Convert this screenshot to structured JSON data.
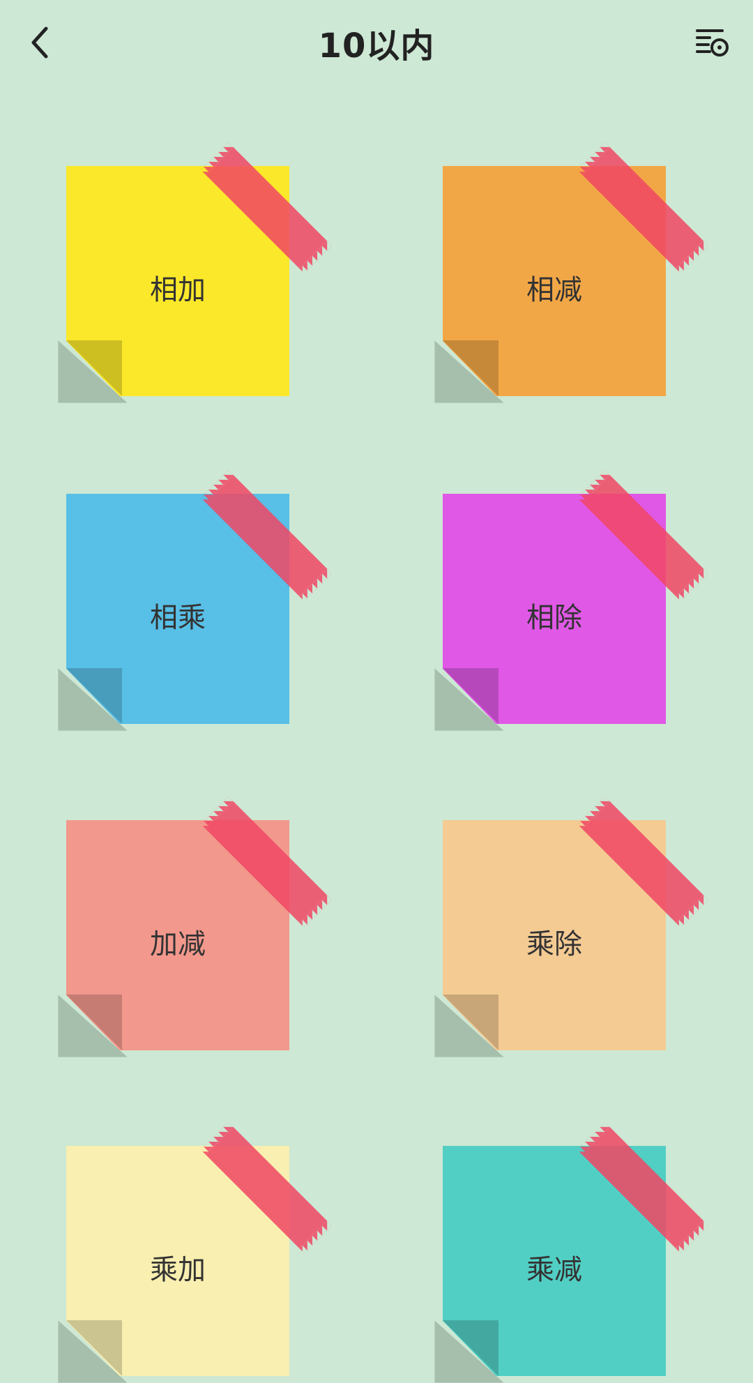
{
  "header": {
    "title": "10以内"
  },
  "notes": [
    {
      "label": "相加",
      "color": "#fbe82a"
    },
    {
      "label": "相减",
      "color": "#f2a746"
    },
    {
      "label": "相乘",
      "color": "#58bfe6"
    },
    {
      "label": "相除",
      "color": "#e058e6"
    },
    {
      "label": "加减",
      "color": "#f2988c"
    },
    {
      "label": "乘除",
      "color": "#f4cb93"
    },
    {
      "label": "乘加",
      "color": "#f8efb0"
    },
    {
      "label": "乘减",
      "color": "#52cfc4"
    }
  ],
  "tape_color": "#f04664"
}
